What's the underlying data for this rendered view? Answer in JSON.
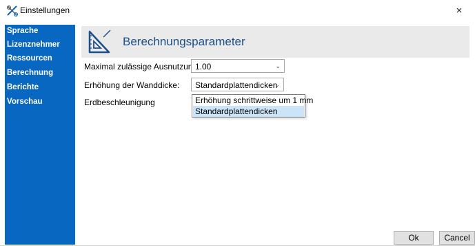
{
  "window": {
    "title": "Einstellungen",
    "close_glyph": "×"
  },
  "sidebar": {
    "items": [
      {
        "label": "Sprache"
      },
      {
        "label": "Lizenznehmer"
      },
      {
        "label": "Ressourcen"
      },
      {
        "label": "Berechnung"
      },
      {
        "label": "Berichte"
      },
      {
        "label": "Vorschau"
      }
    ]
  },
  "header": {
    "title": "Berechnungsparameter",
    "icon": "set-square-icon"
  },
  "form": {
    "max_utilization": {
      "label": "Maximal zulässige Ausnutzung",
      "value": "1.00"
    },
    "wall_thickness": {
      "label": "Erhöhung der Wanddicke:",
      "value": "Standardplattendicken",
      "options": [
        "Erhöhung schrittweise um 1 mm",
        "Standardplattendicken"
      ]
    },
    "gravity": {
      "label": "Erdbeschleunigung"
    }
  },
  "buttons": {
    "ok": "Ok",
    "cancel": "Cancel"
  },
  "colors": {
    "sidebar": "#0867c1",
    "header_bg": "#eaeaea",
    "header_text": "#1c4e8a",
    "selected_option": "#cce4f7"
  }
}
